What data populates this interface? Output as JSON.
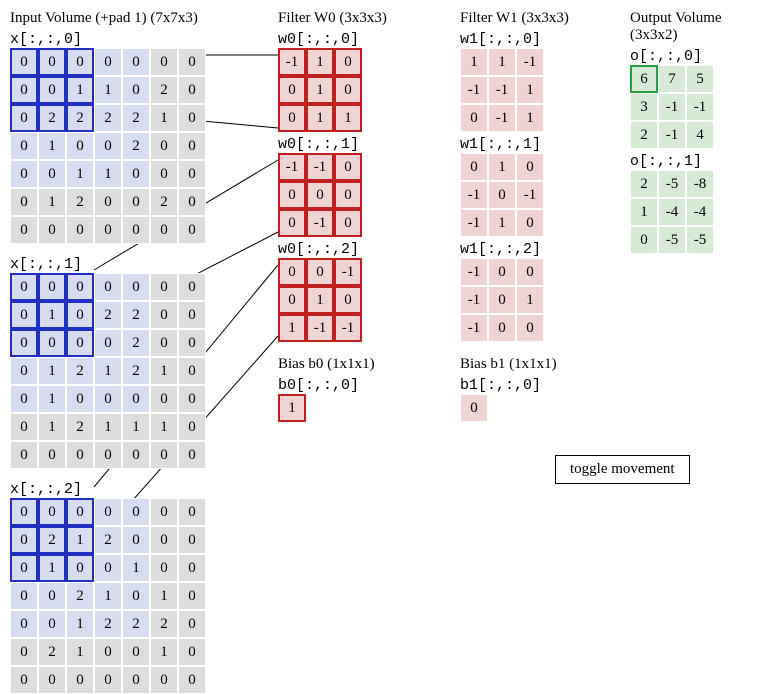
{
  "headings": {
    "input": "Input Volume (+pad 1) (7x7x3)",
    "filter0": "Filter W0 (3x3x3)",
    "filter1": "Filter W1 (3x3x3)",
    "output": "Output Volume (3x3x2)",
    "bias0": "Bias b0 (1x1x1)",
    "bias1": "Bias b1 (1x1x1)"
  },
  "labels": {
    "x0": "x[:,:,0]",
    "x1": "x[:,:,1]",
    "x2": "x[:,:,2]",
    "w00": "w0[:,:,0]",
    "w01": "w0[:,:,1]",
    "w02": "w0[:,:,2]",
    "w10": "w1[:,:,0]",
    "w11": "w1[:,:,1]",
    "w12": "w1[:,:,2]",
    "b0": "b0[:,:,0]",
    "b1": "b1[:,:,0]",
    "o0": "o[:,:,0]",
    "o1": "o[:,:,1]"
  },
  "toggle_label": "toggle movement",
  "input": {
    "x0": [
      [
        0,
        0,
        0,
        0,
        0,
        0,
        0
      ],
      [
        0,
        0,
        1,
        1,
        0,
        2,
        0
      ],
      [
        0,
        2,
        2,
        2,
        2,
        1,
        0
      ],
      [
        0,
        1,
        0,
        0,
        2,
        0,
        0
      ],
      [
        0,
        0,
        1,
        1,
        0,
        0,
        0
      ],
      [
        0,
        1,
        2,
        0,
        0,
        2,
        0
      ],
      [
        0,
        0,
        0,
        0,
        0,
        0,
        0
      ]
    ],
    "x1": [
      [
        0,
        0,
        0,
        0,
        0,
        0,
        0
      ],
      [
        0,
        1,
        0,
        2,
        2,
        0,
        0
      ],
      [
        0,
        0,
        0,
        0,
        2,
        0,
        0
      ],
      [
        0,
        1,
        2,
        1,
        2,
        1,
        0
      ],
      [
        0,
        1,
        0,
        0,
        0,
        0,
        0
      ],
      [
        0,
        1,
        2,
        1,
        1,
        1,
        0
      ],
      [
        0,
        0,
        0,
        0,
        0,
        0,
        0
      ]
    ],
    "x2": [
      [
        0,
        0,
        0,
        0,
        0,
        0,
        0
      ],
      [
        0,
        2,
        1,
        2,
        0,
        0,
        0
      ],
      [
        0,
        1,
        0,
        0,
        1,
        0,
        0
      ],
      [
        0,
        0,
        2,
        1,
        0,
        1,
        0
      ],
      [
        0,
        0,
        1,
        2,
        2,
        2,
        0
      ],
      [
        0,
        2,
        1,
        0,
        0,
        1,
        0
      ],
      [
        0,
        0,
        0,
        0,
        0,
        0,
        0
      ]
    ]
  },
  "filter0": {
    "w00": [
      [
        -1,
        1,
        0
      ],
      [
        0,
        1,
        0
      ],
      [
        0,
        1,
        1
      ]
    ],
    "w01": [
      [
        -1,
        -1,
        0
      ],
      [
        0,
        0,
        0
      ],
      [
        0,
        -1,
        0
      ]
    ],
    "w02": [
      [
        0,
        0,
        -1
      ],
      [
        0,
        1,
        0
      ],
      [
        1,
        -1,
        -1
      ]
    ]
  },
  "filter1": {
    "w10": [
      [
        1,
        1,
        -1
      ],
      [
        -1,
        -1,
        1
      ],
      [
        0,
        -1,
        1
      ]
    ],
    "w11": [
      [
        0,
        1,
        0
      ],
      [
        -1,
        0,
        -1
      ],
      [
        -1,
        1,
        0
      ]
    ],
    "w12": [
      [
        -1,
        0,
        0
      ],
      [
        -1,
        0,
        1
      ],
      [
        -1,
        0,
        0
      ]
    ]
  },
  "bias": {
    "b0": [
      [
        1
      ]
    ],
    "b1": [
      [
        0
      ]
    ]
  },
  "output": {
    "o0": [
      [
        6,
        7,
        5
      ],
      [
        3,
        -1,
        -1
      ],
      [
        2,
        -1,
        4
      ]
    ],
    "o1": [
      [
        2,
        -5,
        -8
      ],
      [
        1,
        -4,
        -4
      ],
      [
        0,
        -5,
        -5
      ]
    ]
  },
  "highlight": {
    "input_window": {
      "row": 0,
      "col": 0,
      "size": 3
    },
    "input_shade": {
      "row": 0,
      "col": 0,
      "size": 5
    },
    "output_cell": {
      "row": 0,
      "col": 0
    }
  }
}
